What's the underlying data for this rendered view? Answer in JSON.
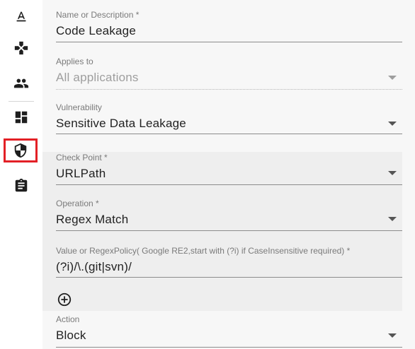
{
  "form": {
    "name": {
      "label": "Name or Description *",
      "value": "Code Leakage"
    },
    "applies_to": {
      "label": "Applies to",
      "value": "All applications"
    },
    "vulnerability": {
      "label": "Vulnerability",
      "value": "Sensitive Data Leakage"
    },
    "check_point": {
      "label": "Check Point *",
      "value": "URLPath"
    },
    "operation": {
      "label": "Operation *",
      "value": "Regex Match"
    },
    "regex": {
      "label": "Value or RegexPolicy( Google RE2,start with (?i) if CaseInsensitive required) *",
      "value": "(?i)/\\.(git|svn)/"
    },
    "action": {
      "label": "Action",
      "value": "Block"
    }
  },
  "sidebar": {
    "icons": [
      "text-format-icon",
      "gamepad-icon",
      "users-icon",
      "dashboard-icon",
      "shield-icon",
      "clipboard-icon"
    ],
    "selected": "shield-icon",
    "selected_outline_color": "#e32026"
  },
  "colors": {
    "background": "#f7f7f7",
    "shaded_field": "#eeeeee",
    "text": "#222222",
    "label": "#7a7a7a"
  }
}
